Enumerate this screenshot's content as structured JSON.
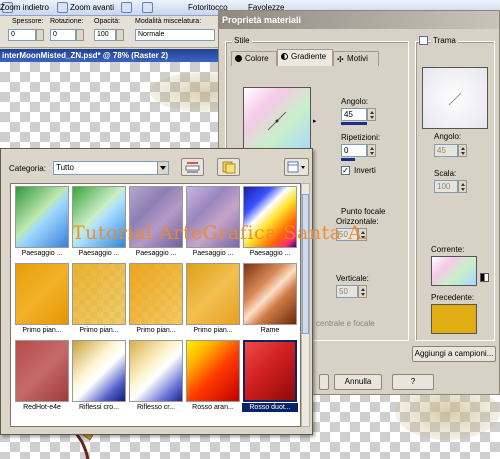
{
  "toolbar": {
    "back_label": "Zoom indietro",
    "forward_label": "Zoom avanti",
    "menu_photo": "Fotoritocco",
    "menu_fav": "Favolezze"
  },
  "options": {
    "thickness_label": "Spessore:",
    "thickness_value": "0",
    "rotation_label": "Rotazione:",
    "rotation_value": "0",
    "opacity_label": "Opacità:",
    "opacity_value": "100",
    "blend_label": "Modalità miscelatura:",
    "blend_value": "Normale"
  },
  "document": {
    "title": "interMoonMisted_ZN.psd* @ 78% (Raster 2)"
  },
  "dialog": {
    "title": "Proprietà materiali",
    "style_group": "Stile",
    "tabs": [
      "Colore",
      "Gradiente",
      "Motivi"
    ],
    "active_tab": "Gradiente",
    "angle_label": "Angolo:",
    "angle_value": "45",
    "repeat_label": "Ripetizioni:",
    "repeat_value": "0",
    "invert_label": "Inverti",
    "invert_checked": "✓",
    "focal_label": "Punto focale",
    "horizontal_label": "Orizzontale:",
    "horizontal_value": "50",
    "vertical_label": "Verticale:",
    "vertical_value": "50",
    "link_label": "centrale e focale",
    "texture_label": "Trama",
    "tex_angle_label": "Angolo:",
    "tex_angle_value": "45",
    "tex_scale_label": "Scala:",
    "tex_scale_value": "100",
    "current_label": "Corrente:",
    "previous_label": "Precedente:",
    "add_swatch_button": "Aggiungi a campioni...",
    "cancel_button": "Annulla",
    "help_button": "?"
  },
  "picker": {
    "category_label": "Categoria:",
    "category_value": "Tutto",
    "items": [
      {
        "label": "Paesaggio ...",
        "bg": "linear-gradient(135deg,#2f9a3a 0%,#bfe8b3 45%,#9fd8ff 55%,#3b7fd8 100%)"
      },
      {
        "label": "Paesaggio ...",
        "bg": "linear-gradient(135deg,#3aa33a 0%,#cbeec8 45%,#aee0ff 55%,#2f86de 100%)"
      },
      {
        "label": "Paesaggio ...",
        "bg": "linear-gradient(135deg,#b7a6cf 0%,#8e7fb2 35%,#b49bc7 60%,#6d5fa0 100%)"
      },
      {
        "label": "Paesaggio ...",
        "bg": "linear-gradient(135deg,#c9b6de 0%,#9a86be 35%,#c6a4c8 60%,#7868aa 100%)"
      },
      {
        "label": "Paesaggio ...",
        "bg": "linear-gradient(135deg,#1b1fa0 0%,#3c52ff 25%,#ffffff 40%,#ffe12a 55%,#ff6a00 75%,#ff2a6e 90%,#1a0f80 100%)"
      },
      {
        "label": "Primo pian...",
        "bg": "linear-gradient(135deg,#e89d08 0%,#f2b22a 50%,#e69500 100%)"
      },
      {
        "label": "Primo pian...",
        "bg": "linear-gradient(135deg,rgba(232,170,30,0.9) 0%,rgba(235,190,60,0.75) 100%)"
      },
      {
        "label": "Primo pian...",
        "bg": "linear-gradient(135deg,rgba(236,160,20,0.95) 0%,rgba(240,190,60,0.8) 100%)"
      },
      {
        "label": "Primo pian...",
        "bg": "linear-gradient(135deg,#e0a01a 0%,#f3c050 50%,#e8a020 100%)"
      },
      {
        "label": "Rame",
        "bg": "linear-gradient(135deg,#7a3412 0%,#d98a58 35%,#fde0c8 50%,#d07a48 65%,#6a2a0a 100%)"
      },
      {
        "label": "RedHot-e4e",
        "bg": "linear-gradient(135deg,#b84a4a 0%,#c56a6a 50%,#a03a3a 100%)"
      },
      {
        "label": "Riflessi cro...",
        "bg": "linear-gradient(135deg,#c8a13a 0%,#fff6d8 40%,#ffffff 55%,#5560c8 80%,#101a7a 100%)"
      },
      {
        "label": "Riflesso cr...",
        "bg": "linear-gradient(135deg,#d8b04a 0%,#fff3cc 40%,#ffffff 55%,#6d78d8 80%,#1a2585 100%)"
      },
      {
        "label": "Rosso aran...",
        "bg": "linear-gradient(135deg,#ffee00 0%,#ffb000 25%,#ff3a00 55%,#c00000 100%)"
      },
      {
        "label": "Rosso duot...",
        "bg": "linear-gradient(135deg,#f04a4a 0%,#d02020 45%,#900808 100%)"
      }
    ],
    "selected_index": 14
  },
  "watermark": "Tutorial ArteGrafica Santa A.",
  "colors": {
    "current_gradient": "linear-gradient(135deg,#ffffff 0%,#f6c9e8 30%,#c9f0c9 60%,#a9d6ff 100%)",
    "previous_swatch": "#e0ad12",
    "dialog_title_bar": "#8e8a82",
    "selection": "#0a246a"
  }
}
